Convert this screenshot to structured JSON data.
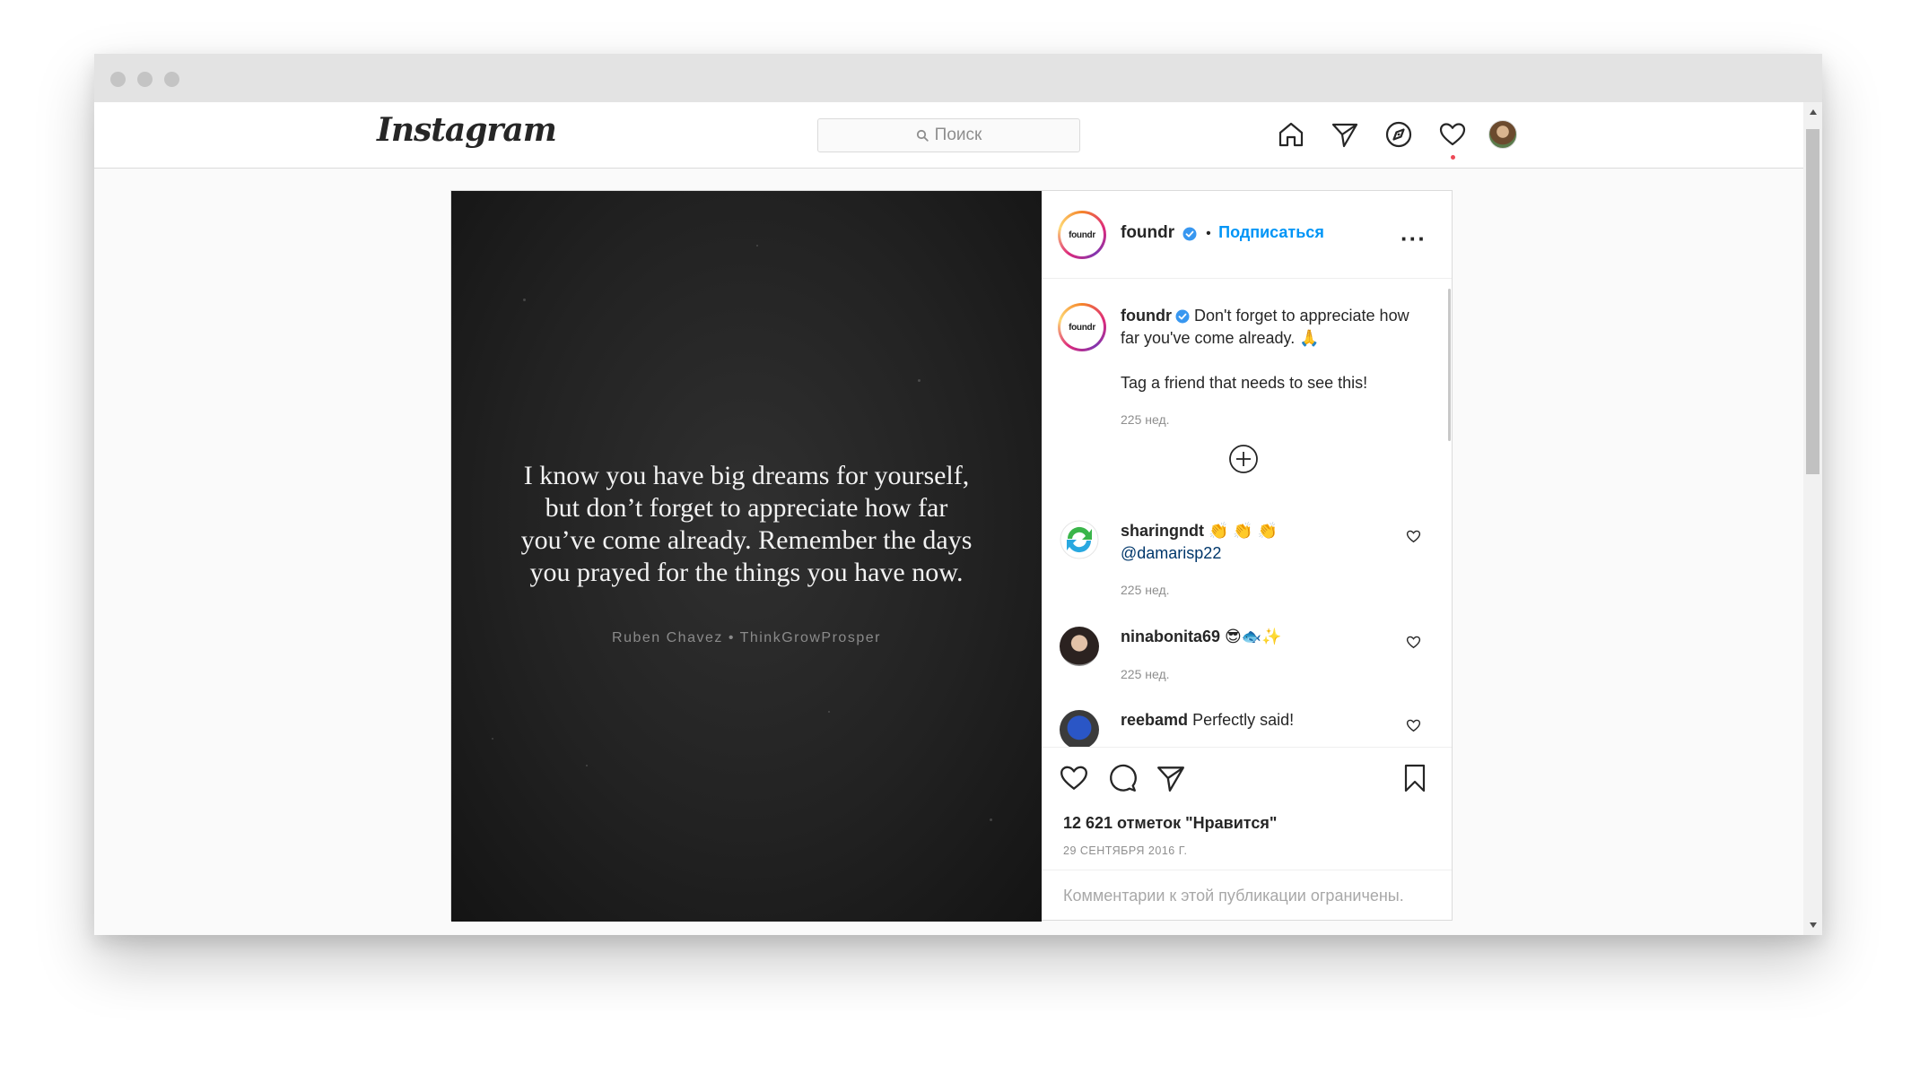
{
  "nav": {
    "logo": "Instagram",
    "search_placeholder": "Поиск"
  },
  "post": {
    "image": {
      "quote": "I know you have big dreams for yourself, but don’t forget to appreciate how far you’ve come already. Remember the days you prayed for the things you have now.",
      "credit": "Ruben Chavez • ThinkGrowProsper"
    },
    "header": {
      "avatar_text": "foundr",
      "username": "foundr",
      "separator": "•",
      "follow_label": "Подписаться"
    },
    "caption": {
      "avatar_text": "foundr",
      "username": "foundr",
      "text": "Don't forget to appreciate how far you've come already. 🙏",
      "text2": "Tag a friend that needs to see this!",
      "time": "225 нед."
    },
    "comments": [
      {
        "username": "sharingndt",
        "text": "👏 👏 👏",
        "mention": "@damarisp22",
        "time": "225 нед."
      },
      {
        "username": "ninabonita69",
        "text": "😎🐟✨",
        "time": "225 нед."
      },
      {
        "username": "reebamd",
        "text": "Perfectly said!"
      }
    ],
    "likes": "12 621 отметок \"Нравится\"",
    "date": "29 СЕНТЯБРЯ 2016 Г.",
    "comments_limited": "Комментарии к этой публикации ограничены."
  },
  "colors": {
    "accent": "#0095f6",
    "notification": "#ed4956",
    "text": "#262626",
    "muted": "#8e8e8e"
  }
}
